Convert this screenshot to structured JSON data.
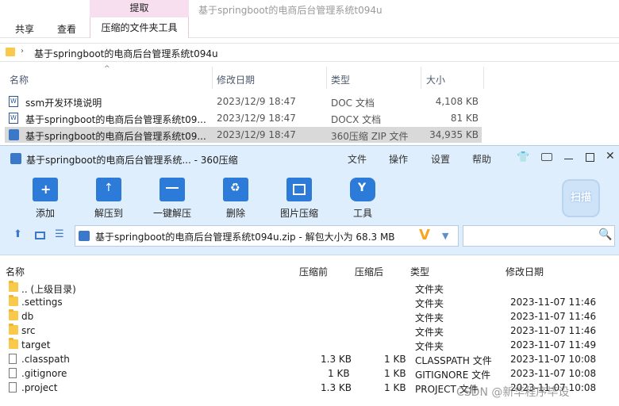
{
  "explorer": {
    "ribbon": {
      "context_tab": "提取",
      "tabs": [
        "共享",
        "查看",
        "压缩的文件夹工具"
      ],
      "window_title": "基于springboot的电商后台管理系统t094u"
    },
    "address_path": "基于springboot的电商后台管理系统t094u",
    "columns": [
      "名称",
      "修改日期",
      "类型",
      "大小"
    ],
    "rows": [
      {
        "name": "ssm开发环境说明",
        "date": "2023/12/9 18:47",
        "type": "DOC 文档",
        "size": "4,108 KB"
      },
      {
        "name": "基于springboot的电商后台管理系统t09...",
        "date": "2023/12/9 18:47",
        "type": "DOCX 文档",
        "size": "81 KB"
      },
      {
        "name": "基于springboot的电商后台管理系统t09...",
        "date": "2023/12/9 18:47",
        "type": "360压缩 ZIP 文件",
        "size": "34,935 KB"
      }
    ]
  },
  "zip": {
    "title": "基于springboot的电商后台管理系统... - 360压缩",
    "menus": [
      "文件",
      "操作",
      "设置",
      "帮助"
    ],
    "toolbar": [
      "添加",
      "解压到",
      "一键解压",
      "删除",
      "图片压缩",
      "工具"
    ],
    "scan_label": "扫描",
    "path_text": "基于springboot的电商后台管理系统t094u.zip - 解包大小为 68.3 MB",
    "columns": [
      "名称",
      "压缩前",
      "压缩后",
      "类型",
      "修改日期"
    ],
    "rows": [
      {
        "name": ".. (上级目录)",
        "before": "",
        "after": "",
        "type": "文件夹",
        "date": "",
        "kind": "folder"
      },
      {
        "name": ".settings",
        "before": "",
        "after": "",
        "type": "文件夹",
        "date": "2023-11-07 11:46",
        "kind": "folder"
      },
      {
        "name": "db",
        "before": "",
        "after": "",
        "type": "文件夹",
        "date": "2023-11-07 11:46",
        "kind": "folder"
      },
      {
        "name": "src",
        "before": "",
        "after": "",
        "type": "文件夹",
        "date": "2023-11-07 11:46",
        "kind": "folder"
      },
      {
        "name": "target",
        "before": "",
        "after": "",
        "type": "文件夹",
        "date": "2023-11-07 11:49",
        "kind": "folder"
      },
      {
        "name": ".classpath",
        "before": "1.3 KB",
        "after": "1 KB",
        "type": "CLASSPATH 文件",
        "date": "2023-11-07 10:08",
        "kind": "file"
      },
      {
        "name": ".gitignore",
        "before": "1 KB",
        "after": "1 KB",
        "type": "GITIGNORE 文件",
        "date": "2023-11-07 10:08",
        "kind": "file"
      },
      {
        "name": ".project",
        "before": "1.3 KB",
        "after": "1 KB",
        "type": "PROJECT 文件",
        "date": "2023-11-07 10:08",
        "kind": "file"
      }
    ]
  },
  "watermark": "CSDN @新华程序毕设"
}
